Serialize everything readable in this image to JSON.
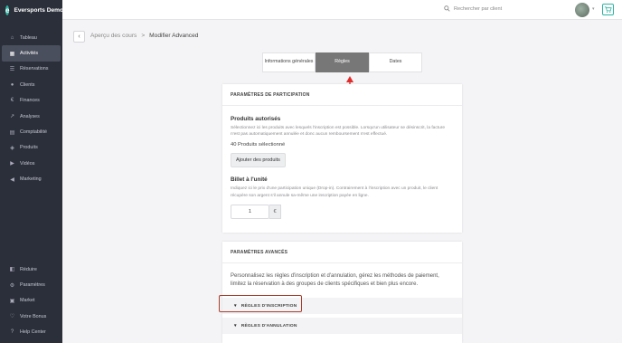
{
  "app": {
    "name": "Eversports Demo"
  },
  "sidebar": {
    "items": [
      {
        "label": "Tableau",
        "icon": "home-icon"
      },
      {
        "label": "Activités",
        "icon": "activity-icon"
      },
      {
        "label": "Réservations",
        "icon": "list-icon"
      },
      {
        "label": "Clients",
        "icon": "user-icon"
      },
      {
        "label": "Finances",
        "icon": "euro-icon"
      },
      {
        "label": "Analyses",
        "icon": "chart-icon"
      },
      {
        "label": "Comptabilité",
        "icon": "document-icon"
      },
      {
        "label": "Produits",
        "icon": "tag-icon"
      },
      {
        "label": "Vidéos",
        "icon": "play-icon"
      },
      {
        "label": "Marketing",
        "icon": "megaphone-icon"
      }
    ],
    "bottom_items": [
      {
        "label": "Réduire",
        "icon": "collapse-icon"
      },
      {
        "label": "Paramètres",
        "icon": "gear-icon"
      },
      {
        "label": "Market",
        "icon": "store-icon"
      },
      {
        "label": "Votre Bonus",
        "icon": "heart-icon"
      },
      {
        "label": "Help Center",
        "icon": "help-icon"
      }
    ]
  },
  "topbar": {
    "search_placeholder": "Rechercher par client"
  },
  "breadcrumb": {
    "parent": "Aperçu des cours",
    "separator": ">",
    "current": "Modifier Advanced"
  },
  "tabs": [
    {
      "label": "Informations générales"
    },
    {
      "label": "Règles",
      "active": true
    },
    {
      "label": "Dates"
    }
  ],
  "participation": {
    "header": "PARAMÈTRES DE PARTICIPATION",
    "products_title": "Produits autorisés",
    "products_desc": "Sélectionnez ici les produits avec lesquels l'inscription est possible. Lorsqu'un utilisateur se désinscrit, la facture n'est pas automatiquement annulée et donc aucun remboursement n'est effectué.",
    "products_count": "40 Produits sélectionné",
    "add_button": "Ajouter des produits",
    "ticket_title": "Billet à l'unité",
    "ticket_desc": "Indiquez ici le prix d'une participation unique (Drop-in). Contrairement à l'inscription avec un produit, le client récupère son argent s'il annule sa-même une inscription payée en ligne.",
    "price_value": "1",
    "currency": "€"
  },
  "advanced": {
    "header": "PARAMÈTRES AVANCÉS",
    "description": "Personnalisez les règles d'inscription et d'annulation, gérez les méthodes de paiement, limitez la réservation à des groupes de clients spécifiques et bien plus encore.",
    "sections": [
      {
        "label": "RÈGLES D'INSCRIPTION"
      },
      {
        "label": "RÈGLES D'ANNULATION"
      }
    ]
  },
  "colors": {
    "accent": "#2bb5a3",
    "sidebar": "#2b2f3a",
    "annotation": "#e02b2b",
    "highlight": "#a53e2e"
  }
}
